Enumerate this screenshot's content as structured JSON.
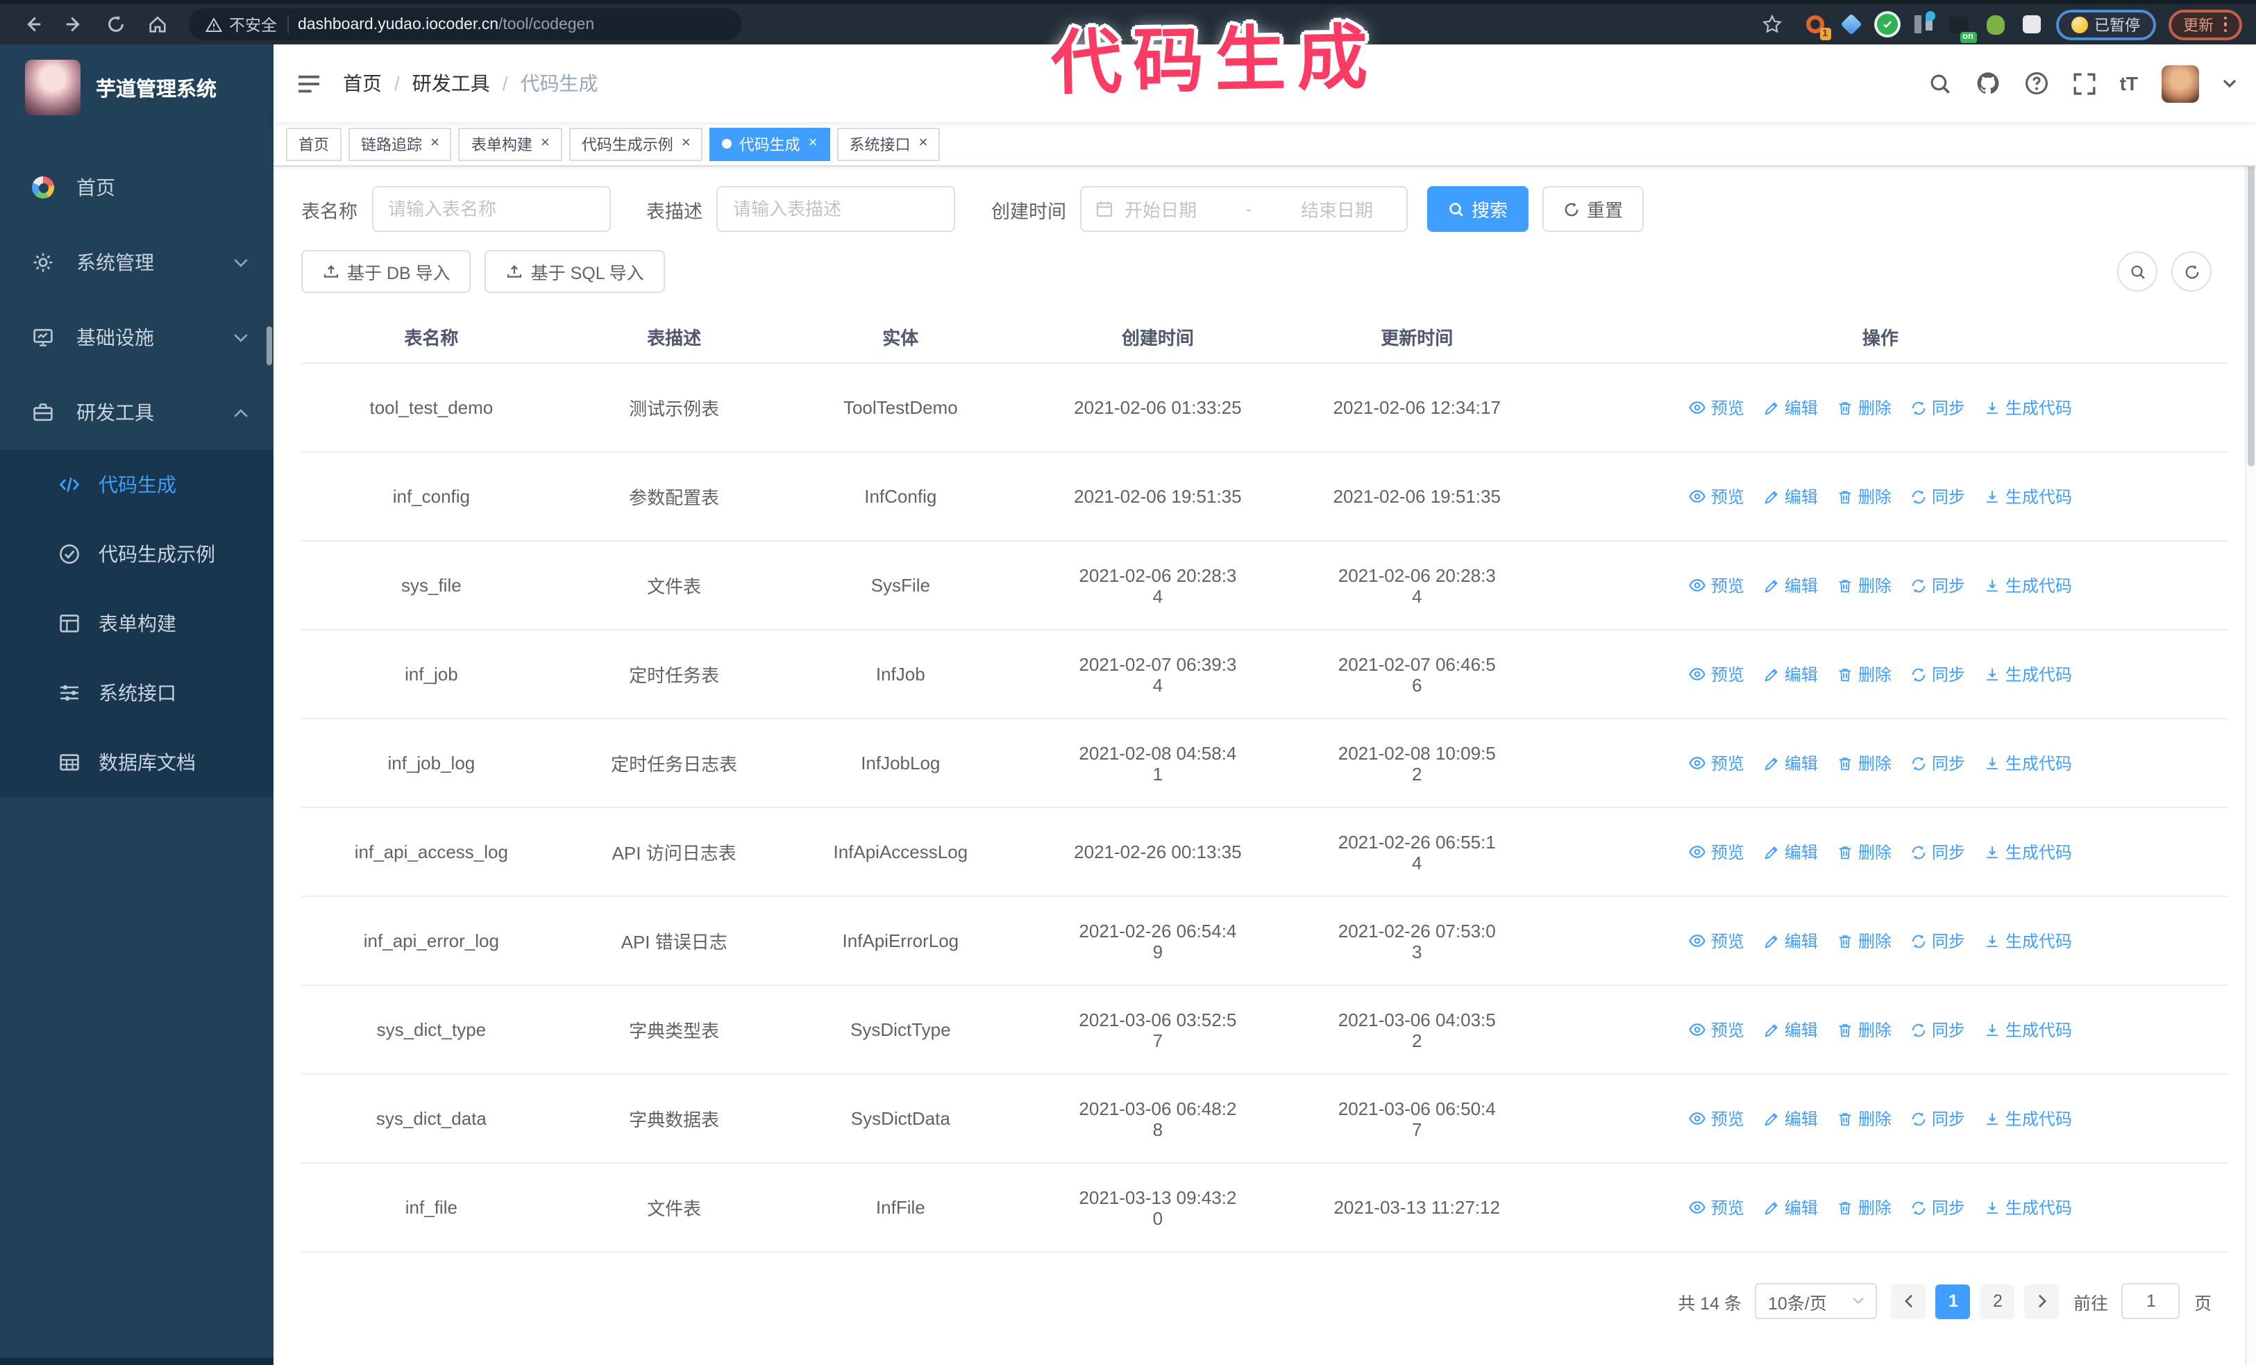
{
  "browser": {
    "insecure_label": "不安全",
    "url_host": "dashboard.yudao.iocoder.cn",
    "url_path": "/tool/codegen",
    "ext_badge": "1",
    "ext_on_badge": "on",
    "paused_label": "已暂停",
    "update_label": "更新"
  },
  "overlay": {
    "title": "代码生成"
  },
  "sidebar": {
    "app_title": "芋道管理系统",
    "items": [
      {
        "label": "首页",
        "icon": "dashboard",
        "chevron": null,
        "active": false
      },
      {
        "label": "系统管理",
        "icon": "gear",
        "chevron": "down",
        "active": false
      },
      {
        "label": "基础设施",
        "icon": "monitor",
        "chevron": "down",
        "active": false
      },
      {
        "label": "研发工具",
        "icon": "tool",
        "chevron": "up",
        "active": false
      }
    ],
    "subitems": [
      {
        "label": "代码生成",
        "icon": "code",
        "active": true
      },
      {
        "label": "代码生成示例",
        "icon": "example",
        "active": false
      },
      {
        "label": "表单构建",
        "icon": "form",
        "active": false
      },
      {
        "label": "系统接口",
        "icon": "api",
        "active": false
      },
      {
        "label": "数据库文档",
        "icon": "dbdoc",
        "active": false
      }
    ]
  },
  "header": {
    "breadcrumb": [
      "首页",
      "研发工具",
      "代码生成"
    ]
  },
  "tabs": [
    {
      "label": "首页",
      "closable": false,
      "active": false
    },
    {
      "label": "链路追踪",
      "closable": true,
      "active": false
    },
    {
      "label": "表单构建",
      "closable": true,
      "active": false
    },
    {
      "label": "代码生成示例",
      "closable": true,
      "active": false
    },
    {
      "label": "代码生成",
      "closable": true,
      "active": true
    },
    {
      "label": "系统接口",
      "closable": true,
      "active": false
    }
  ],
  "filters": {
    "name_label": "表名称",
    "name_placeholder": "请输入表名称",
    "desc_label": "表描述",
    "desc_placeholder": "请输入表描述",
    "time_label": "创建时间",
    "start_placeholder": "开始日期",
    "range_separator": "-",
    "end_placeholder": "结束日期",
    "search_label": "搜索",
    "reset_label": "重置"
  },
  "toolbar": {
    "import_db_label": "基于 DB 导入",
    "import_sql_label": "基于 SQL 导入"
  },
  "table": {
    "columns": [
      "表名称",
      "表描述",
      "实体",
      "创建时间",
      "更新时间",
      "操作"
    ],
    "actions": [
      "预览",
      "编辑",
      "删除",
      "同步",
      "生成代码"
    ],
    "rows": [
      {
        "name": "tool_test_demo",
        "desc": "测试示例表",
        "entity": "ToolTestDemo",
        "created": "2021-02-06 01:33:25",
        "updated": "2021-02-06 12:34:17"
      },
      {
        "name": "inf_config",
        "desc": "参数配置表",
        "entity": "InfConfig",
        "created": "2021-02-06 19:51:35",
        "updated": "2021-02-06 19:51:35"
      },
      {
        "name": "sys_file",
        "desc": "文件表",
        "entity": "SysFile",
        "created": "2021-02-06 20:28:3\n4",
        "updated": "2021-02-06 20:28:3\n4"
      },
      {
        "name": "inf_job",
        "desc": "定时任务表",
        "entity": "InfJob",
        "created": "2021-02-07 06:39:3\n4",
        "updated": "2021-02-07 06:46:5\n6"
      },
      {
        "name": "inf_job_log",
        "desc": "定时任务日志表",
        "entity": "InfJobLog",
        "created": "2021-02-08 04:58:4\n1",
        "updated": "2021-02-08 10:09:5\n2"
      },
      {
        "name": "inf_api_access_log",
        "desc": "API 访问日志表",
        "entity": "InfApiAccessLog",
        "created": "2021-02-26 00:13:35",
        "updated": "2021-02-26 06:55:1\n4"
      },
      {
        "name": "inf_api_error_log",
        "desc": "API 错误日志",
        "entity": "InfApiErrorLog",
        "created": "2021-02-26 06:54:4\n9",
        "updated": "2021-02-26 07:53:0\n3"
      },
      {
        "name": "sys_dict_type",
        "desc": "字典类型表",
        "entity": "SysDictType",
        "created": "2021-03-06 03:52:5\n7",
        "updated": "2021-03-06 04:03:5\n2"
      },
      {
        "name": "sys_dict_data",
        "desc": "字典数据表",
        "entity": "SysDictData",
        "created": "2021-03-06 06:48:2\n8",
        "updated": "2021-03-06 06:50:4\n7"
      },
      {
        "name": "inf_file",
        "desc": "文件表",
        "entity": "InfFile",
        "created": "2021-03-13 09:43:2\n0",
        "updated": "2021-03-13 11:27:12"
      }
    ]
  },
  "pagination": {
    "total_label": "共 14 条",
    "page_size_label": "10条/页",
    "pages": [
      "1",
      "2"
    ],
    "active_page": "1",
    "goto_label": "前往",
    "goto_value": "1",
    "unit_label": "页"
  },
  "colors": {
    "accent": "#409eff",
    "sidebar": "#204158",
    "annotation": "#fa3b63"
  }
}
